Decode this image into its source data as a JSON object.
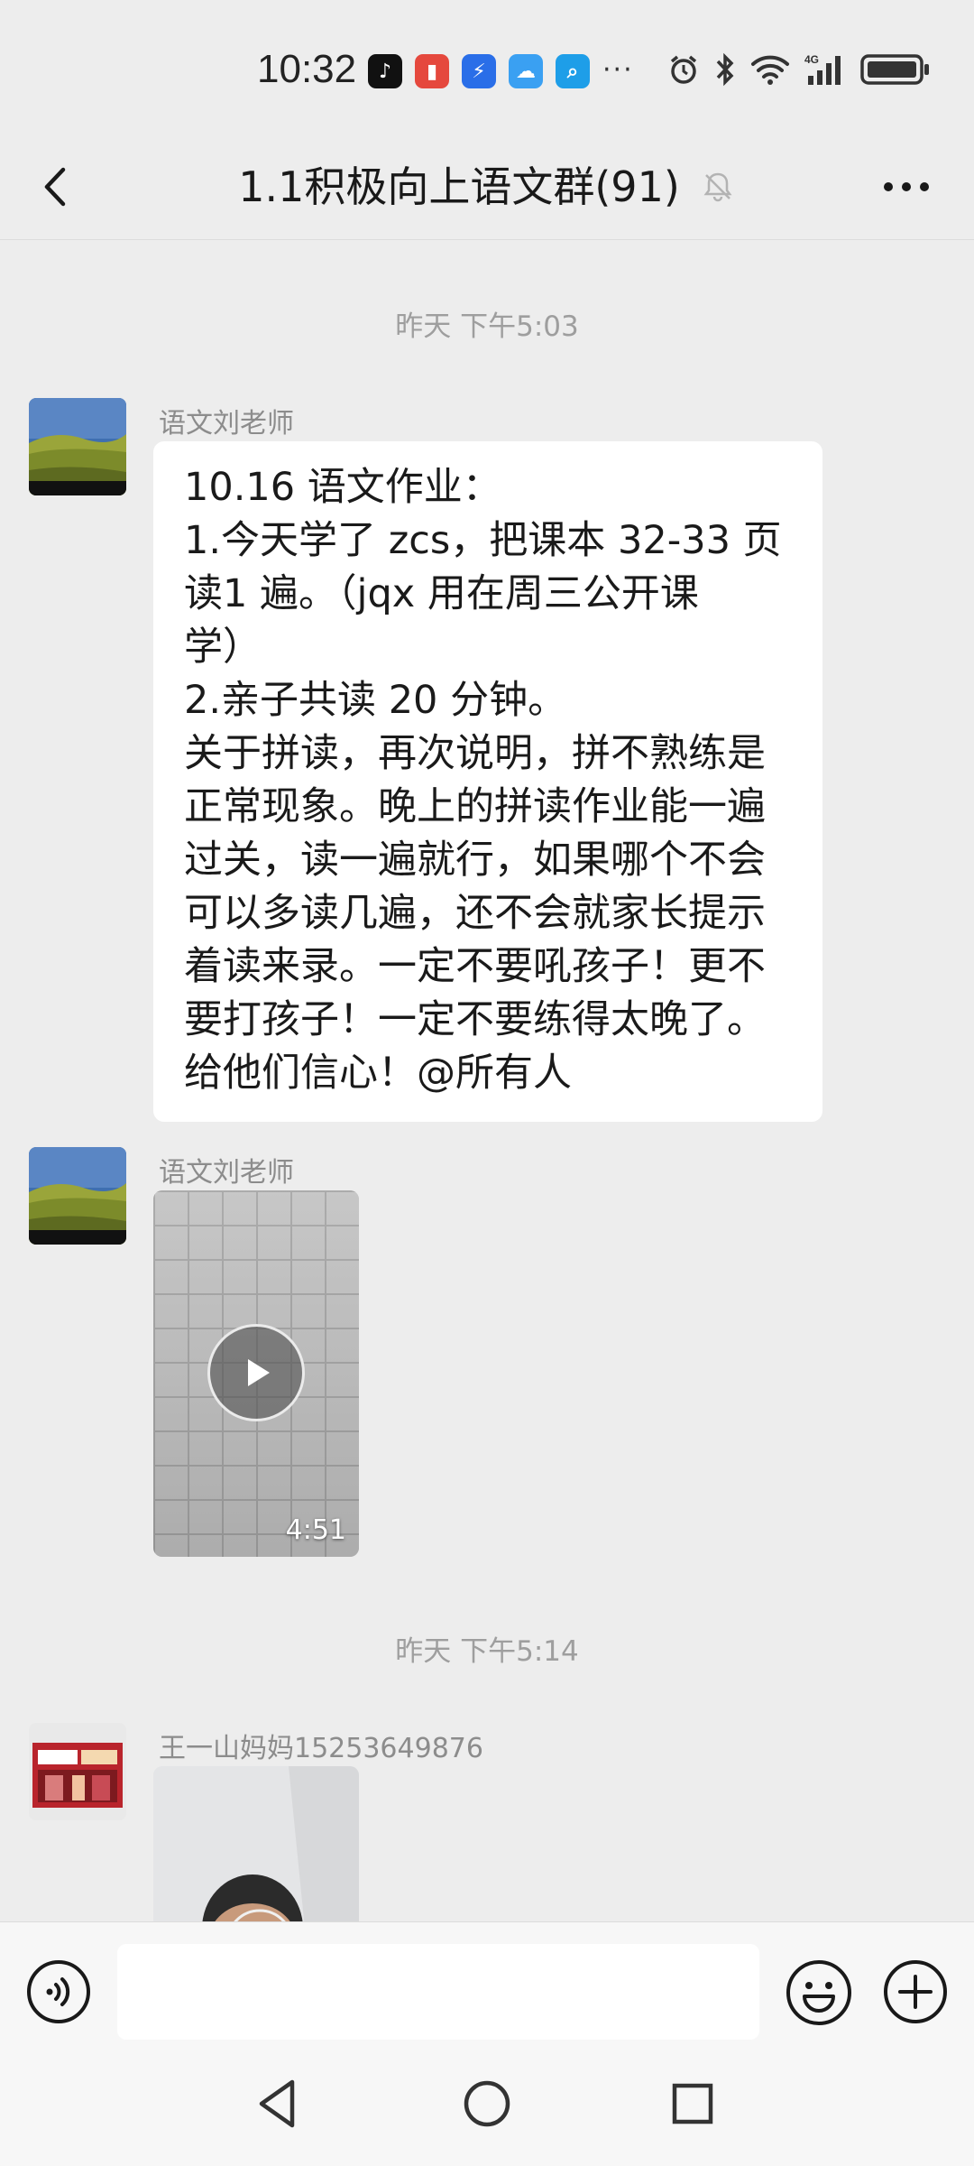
{
  "status_bar": {
    "time": "10:32",
    "app_icons": [
      "tiktok-icon",
      "battery-saver-app-icon",
      "lightning-app-icon",
      "weather-app-icon",
      "search-app-icon"
    ],
    "more": "···",
    "system_icons": [
      "alarm-icon",
      "bluetooth-icon",
      "wifi-icon",
      "4g-signal-icon",
      "battery-icon"
    ]
  },
  "header": {
    "title": "1.1积极向上语文群(91)",
    "muted": true
  },
  "messages": {
    "ts1": "昨天 下午5:03",
    "ts2": "昨天 下午5:14",
    "msg1": {
      "sender": "语文刘老师",
      "lines": [
        "10.16 语文作业：",
        "1.今天学了 zcs，把课本 32-33 页",
        "读1 遍。（jqx 用在周三公开课",
        "学）",
        "2.亲子共读 20 分钟。",
        "关于拼读，再次说明，拼不熟练是",
        "正常现象。晚上的拼读作业能一遍",
        "过关，读一遍就行，如果哪个不会",
        "可以多读几遍，还不会就家长提示",
        "着读来录。一定不要吼孩子！更不",
        "要打孩子！一定不要练得太晚了。",
        "给他们信心！@所有人"
      ]
    },
    "msg2": {
      "sender": "语文刘老师",
      "video_duration": "4:51"
    },
    "msg3": {
      "sender": "王一山妈妈15253649876"
    }
  },
  "input_bar": {
    "voice": "voice-icon",
    "emoji": "emoji-icon",
    "plus": "plus-icon",
    "placeholder": ""
  },
  "colors": {
    "background": "#ededed",
    "bubble": "#ffffff",
    "timestamp": "#9e9e9e",
    "sender": "#8c8c8c"
  }
}
